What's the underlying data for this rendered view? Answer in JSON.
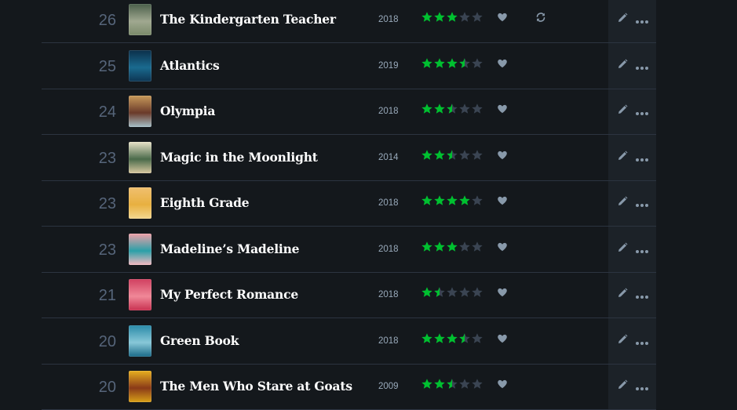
{
  "colors": {
    "background": "#14181c",
    "star_filled": "#00c030",
    "star_empty": "#3a4452",
    "icon": "#8899aa"
  },
  "entries": [
    {
      "day": "26",
      "title": "The Kindergarten Teacher",
      "year": "2018",
      "rating": 3,
      "liked": true,
      "rewatch": true,
      "poster": [
        "#4a5f4a",
        "#a0a890",
        "#7a8a6a"
      ]
    },
    {
      "day": "25",
      "title": "Atlantics",
      "year": "2019",
      "rating": 3.5,
      "liked": true,
      "rewatch": false,
      "poster": [
        "#0b2f4a",
        "#1a6a8f",
        "#0d3552"
      ]
    },
    {
      "day": "24",
      "title": "Olympia",
      "year": "2018",
      "rating": 2.5,
      "liked": true,
      "rewatch": false,
      "poster": [
        "#c89a5a",
        "#6a3a2a",
        "#a6c0c8"
      ]
    },
    {
      "day": "23",
      "title": "Magic in the Moonlight",
      "year": "2014",
      "rating": 2.5,
      "liked": true,
      "rewatch": false,
      "poster": [
        "#e8e2c8",
        "#4a6a4a",
        "#d8c8a0"
      ]
    },
    {
      "day": "23",
      "title": "Eighth Grade",
      "year": "2018",
      "rating": 4,
      "liked": true,
      "rewatch": false,
      "poster": [
        "#f0c070",
        "#e8b040",
        "#f4d890"
      ]
    },
    {
      "day": "23",
      "title": "Madeline’s Madeline",
      "year": "2018",
      "rating": 3,
      "liked": true,
      "rewatch": false,
      "poster": [
        "#f0a0a8",
        "#2aa0a8",
        "#f4b8c0"
      ]
    },
    {
      "day": "21",
      "title": "My Perfect Romance",
      "year": "2018",
      "rating": 1.5,
      "liked": true,
      "rewatch": false,
      "poster": [
        "#d04060",
        "#f08898",
        "#c83050"
      ]
    },
    {
      "day": "20",
      "title": "Green Book",
      "year": "2018",
      "rating": 3.5,
      "liked": true,
      "rewatch": false,
      "poster": [
        "#2a8aa8",
        "#88c8d8",
        "#1a6a88"
      ]
    },
    {
      "day": "20",
      "title": "The Men Who Stare at Goats",
      "year": "2009",
      "rating": 2.5,
      "liked": true,
      "rewatch": false,
      "poster": [
        "#e8b020",
        "#8a3a18",
        "#d8a018"
      ]
    }
  ],
  "icons": {
    "like": "heart-icon",
    "rewatch": "rewatch-icon",
    "edit": "pencil-icon",
    "more": "more-icon",
    "star": "star-icon"
  }
}
